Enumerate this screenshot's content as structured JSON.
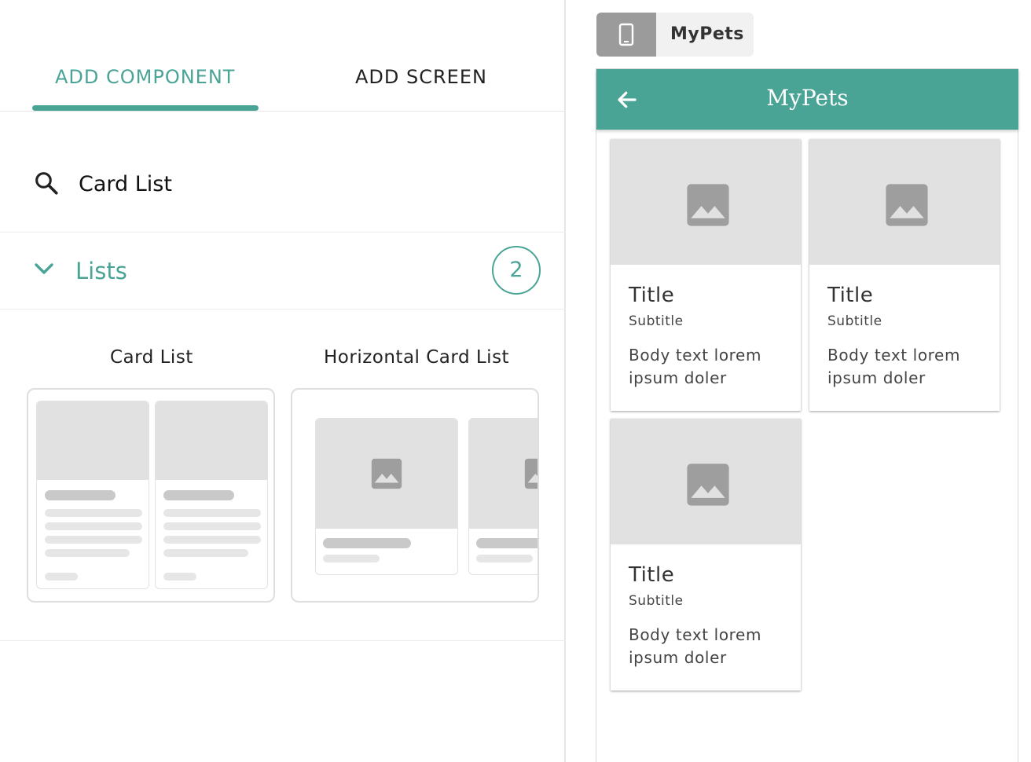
{
  "tabs": {
    "add_component": "ADD COMPONENT",
    "add_screen": "ADD SCREEN"
  },
  "search": {
    "value": "Card List",
    "icon": "search-icon"
  },
  "section": {
    "label": "Lists",
    "count": "2",
    "expanded": true
  },
  "components": [
    {
      "label": "Card List"
    },
    {
      "label": "Horizontal Card List"
    }
  ],
  "device": {
    "name": "MyPets",
    "icon": "phone-icon"
  },
  "app": {
    "title": "MyPets",
    "back_icon": "arrow-left-icon",
    "cards": [
      {
        "title": "Title",
        "subtitle": "Subtitle",
        "body": "Body text lorem ipsum doler"
      },
      {
        "title": "Title",
        "subtitle": "Subtitle",
        "body": "Body text lorem ipsum doler"
      },
      {
        "title": "Title",
        "subtitle": "Subtitle",
        "body": "Body text lorem ipsum doler"
      }
    ]
  },
  "colors": {
    "accent": "#4aa496",
    "placeholder": "#e0e1e0",
    "device_button": "#9b9b9b"
  }
}
